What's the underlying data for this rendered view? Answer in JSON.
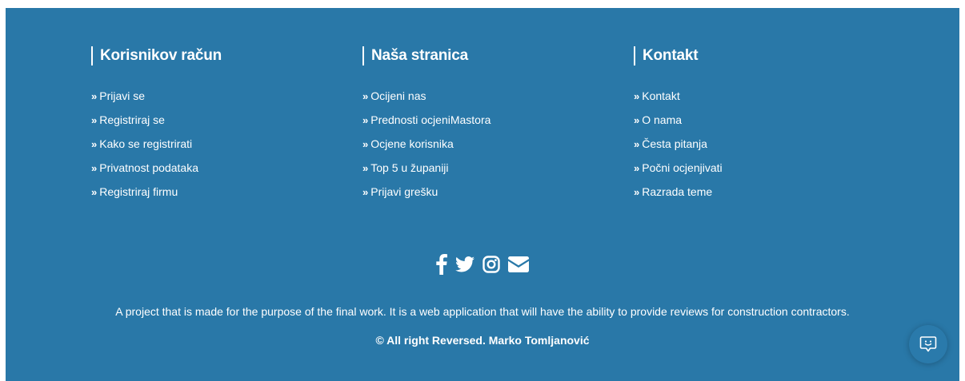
{
  "columns": [
    {
      "title": "Korisnikov račun",
      "links": [
        "Prijavi se",
        "Registriraj se",
        "Kako se registrirati",
        "Privatnost podataka",
        "Registriraj firmu"
      ]
    },
    {
      "title": "Naša stranica",
      "links": [
        "Ocijeni nas",
        "Prednosti ocjeniMastora",
        "Ocjene korisnika",
        "Top 5 u županiji",
        "Prijavi grešku"
      ]
    },
    {
      "title": "Kontakt",
      "links": [
        "Kontakt",
        "O nama",
        "Česta pitanja",
        "Počni ocjenjivati",
        "Razrada teme"
      ]
    }
  ],
  "link_bullet": "»",
  "social_icons": [
    "facebook-icon",
    "twitter-icon",
    "instagram-icon",
    "email-icon"
  ],
  "description": "A project that is made for the purpose of the final work. It is a web application that will have the ability to provide reviews for construction contractors.",
  "copyright": "© All right Reversed.  Marko Tomljanović",
  "chat_icon": "chat-smile-icon",
  "colors": {
    "footer_bg": "#2978a8",
    "text": "#ffffff"
  }
}
